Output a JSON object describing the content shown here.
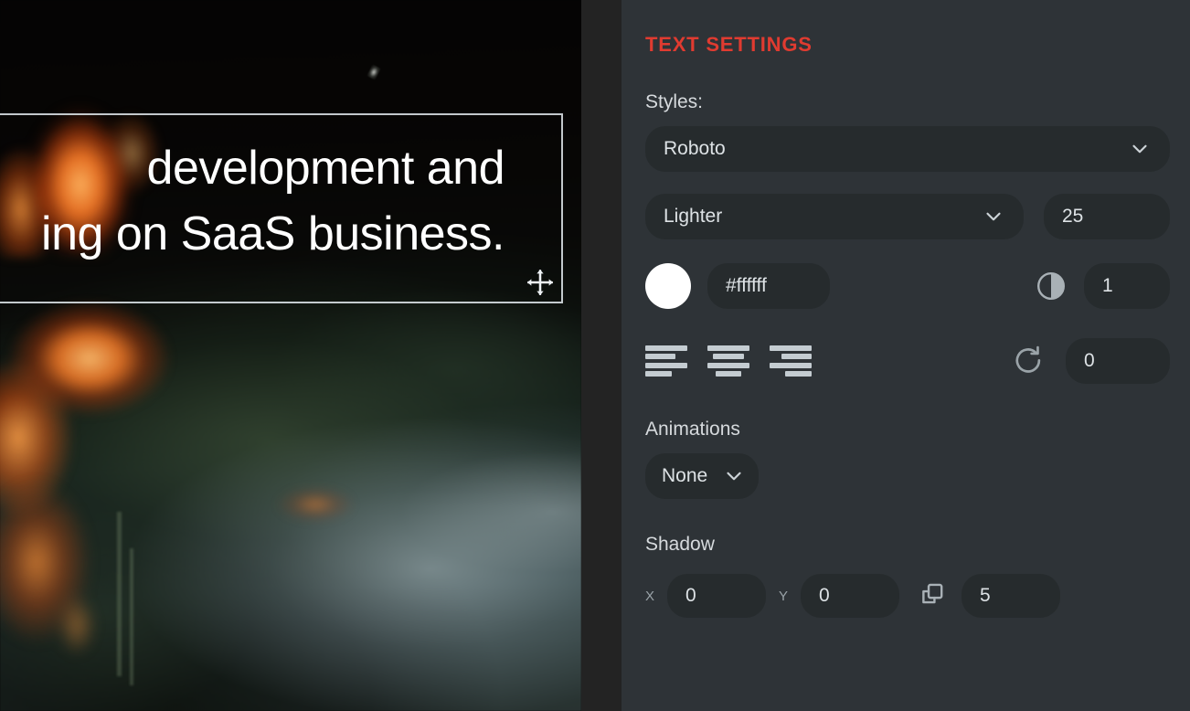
{
  "canvas": {
    "overlay_text": "development and\ning on SaaS business.",
    "move_handle_icon": "move-handle-icon"
  },
  "panel": {
    "title": "TEXT SETTINGS",
    "accent_color": "#e03b30",
    "background_color": "#2e3337",
    "field_color": "#262b2d",
    "styles": {
      "label": "Styles:",
      "font_family": "Roboto",
      "font_weight": "Lighter",
      "font_size": "25",
      "color_hex": "#ffffff",
      "color_swatch": "#ffffff",
      "opacity": "1",
      "rotation": "0",
      "align_options": [
        "align-left",
        "align-center",
        "align-right"
      ],
      "align_selected": "align-left"
    },
    "animations": {
      "label": "Animations",
      "selected": "None"
    },
    "shadow": {
      "label": "Shadow",
      "offset_x": "0",
      "offset_y": "0",
      "blur": "5"
    }
  }
}
